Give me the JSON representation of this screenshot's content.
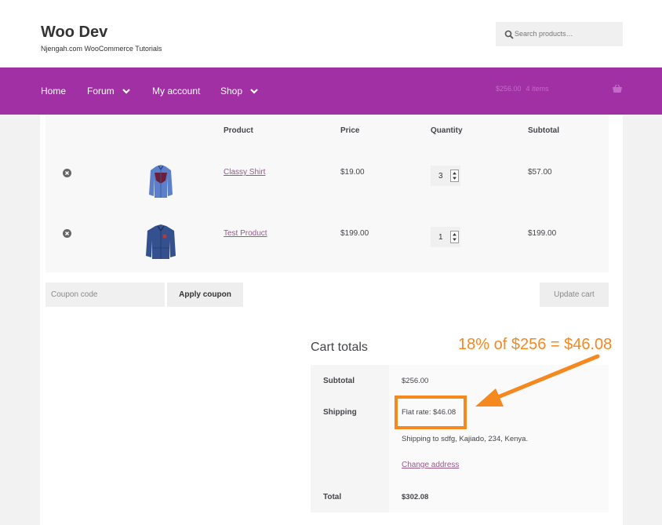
{
  "site": {
    "title": "Woo Dev",
    "description": "Njengah.com WooCommerce Tutorials"
  },
  "search": {
    "placeholder": "Search products…",
    "icon": "search-icon"
  },
  "nav": {
    "items": [
      {
        "label": "Home"
      },
      {
        "label": "Forum"
      },
      {
        "label": "My account"
      },
      {
        "label": "Shop"
      }
    ],
    "cart": {
      "amount": "$256.00",
      "count": "4 items"
    },
    "color": "#a030a4"
  },
  "cart": {
    "headers": {
      "product": "Product",
      "price": "Price",
      "quantity": "Quantity",
      "subtotal": "Subtotal"
    },
    "items": [
      {
        "name": "Classy Shirt",
        "price": "$19.00",
        "quantity": "3",
        "subtotal": "$57.00"
      },
      {
        "name": "Test Product",
        "price": "$199.00",
        "quantity": "1",
        "subtotal": "$199.00"
      }
    ],
    "coupon_placeholder": "Coupon code",
    "apply_coupon": "Apply coupon",
    "update_cart": "Update cart"
  },
  "totals": {
    "title": "Cart totals",
    "subtotal_label": "Subtotal",
    "subtotal_value": "$256.00",
    "shipping_label": "Shipping",
    "shipping_value": "Flat rate: $46.08",
    "shipping_to": "Shipping to sdfg, Kajiado, 234, Kenya.",
    "change_address": "Change address",
    "total_label": "Total",
    "total_value": "$302.08"
  },
  "annotation": {
    "text": "18% of $256 = $46.08",
    "color": "#f5881f"
  }
}
